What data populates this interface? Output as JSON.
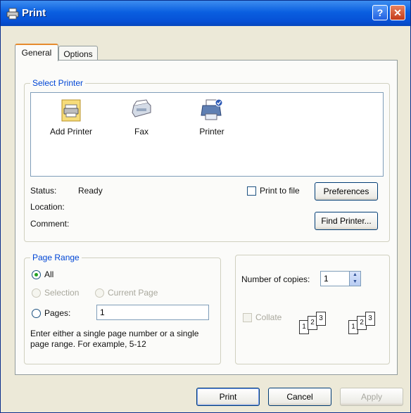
{
  "window": {
    "title": "Print",
    "help_button": "?",
    "close_button": "✕"
  },
  "tabs": [
    {
      "label": "General"
    },
    {
      "label": "Options"
    }
  ],
  "select_printer": {
    "legend": "Select Printer",
    "printers": [
      {
        "label": "Add Printer",
        "icon": "add-printer-icon"
      },
      {
        "label": "Fax",
        "icon": "fax-icon"
      },
      {
        "label": "Printer",
        "icon": "printer-icon"
      }
    ],
    "status_label": "Status:",
    "status_value": "Ready",
    "location_label": "Location:",
    "comment_label": "Comment:",
    "print_to_file_label": "Print to file",
    "preferences_button": "Preferences",
    "find_printer_button": "Find Printer..."
  },
  "page_range": {
    "legend": "Page Range",
    "all_label": "All",
    "selection_label": "Selection",
    "current_page_label": "Current Page",
    "pages_label": "Pages:",
    "pages_value": "1",
    "help_text": "Enter either a single page number or a single page range.  For example, 5-12"
  },
  "copies": {
    "number_label": "Number of copies:",
    "number_value": "1",
    "collate_label": "Collate",
    "collate_sheets_1": [
      "1",
      "2",
      "3"
    ],
    "collate_sheets_2": [
      "1",
      "2",
      "3"
    ]
  },
  "buttons": {
    "print": "Print",
    "cancel": "Cancel",
    "apply": "Apply"
  },
  "colors": {
    "title_bar": "#0a5fe0",
    "legend_text": "#0046d5",
    "tab_highlight": "#e68b2c"
  }
}
